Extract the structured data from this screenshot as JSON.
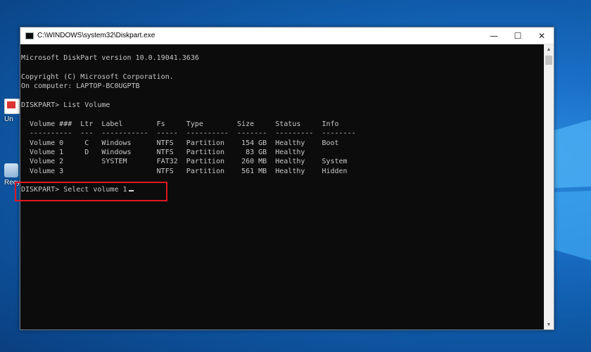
{
  "window": {
    "title": "C:\\WINDOWS\\system32\\Diskpart.exe",
    "buttons": {
      "minimize": "—",
      "maximize": "☐",
      "close": "✕"
    }
  },
  "desktop": {
    "icons": [
      {
        "label": "Un",
        "icon": "app-shortcut-icon"
      },
      {
        "label": "Recy",
        "icon": "recycle-bin-icon"
      }
    ]
  },
  "console": {
    "lines": [
      "Microsoft DiskPart version 10.0.19041.3636",
      "",
      "Copyright (C) Microsoft Corporation.",
      "On computer: LAPTOP-BC0UGPTB",
      "",
      "DISKPART> List Volume",
      "",
      "  Volume ###  Ltr  Label        Fs     Type        Size     Status     Info",
      "  ----------  ---  -----------  -----  ----------  -------  ---------  --------",
      "  Volume 0     C   Windows      NTFS   Partition    154 GB  Healthy    Boot",
      "  Volume 1     D   Windows      NTFS   Partition     83 GB  Healthy",
      "  Volume 2         SYSTEM       FAT32  Partition    260 MB  Healthy    System",
      "  Volume 3                      NTFS   Partition    561 MB  Healthy    Hidden",
      "",
      "DISKPART> Select volume 1"
    ]
  },
  "colors": {
    "console_bg": "#0c0c0c",
    "console_text": "#c8c8c8",
    "highlight": "#e0171f"
  }
}
